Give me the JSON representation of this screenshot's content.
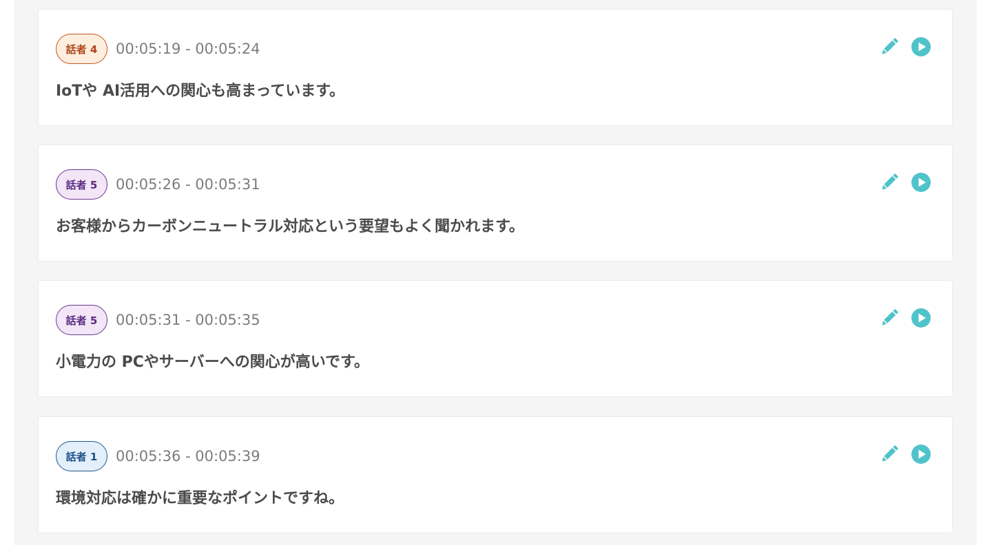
{
  "colors": {
    "accent": "#4fc3c9",
    "text": "#4a4a4a",
    "time": "#7c7c7c",
    "panel_bg": "#f5f5f5"
  },
  "icons": {
    "edit": "pencil-icon",
    "play": "play-circle-icon"
  },
  "segments": [
    {
      "speaker": "話者 4",
      "speaker_style": "s4",
      "time": "00:05:19 - 00:05:24",
      "text": "IoTや AI活用への関心も高まっています。"
    },
    {
      "speaker": "話者 5",
      "speaker_style": "s5",
      "time": "00:05:26 - 00:05:31",
      "text": "お客様からカーボンニュートラル対応という要望もよく聞かれます。"
    },
    {
      "speaker": "話者 5",
      "speaker_style": "s5",
      "time": "00:05:31 - 00:05:35",
      "text": "小電力の PCやサーバーへの関心が高いです。"
    },
    {
      "speaker": "話者 1",
      "speaker_style": "s1",
      "time": "00:05:36 - 00:05:39",
      "text": "環境対応は確かに重要なポイントですね。"
    }
  ]
}
